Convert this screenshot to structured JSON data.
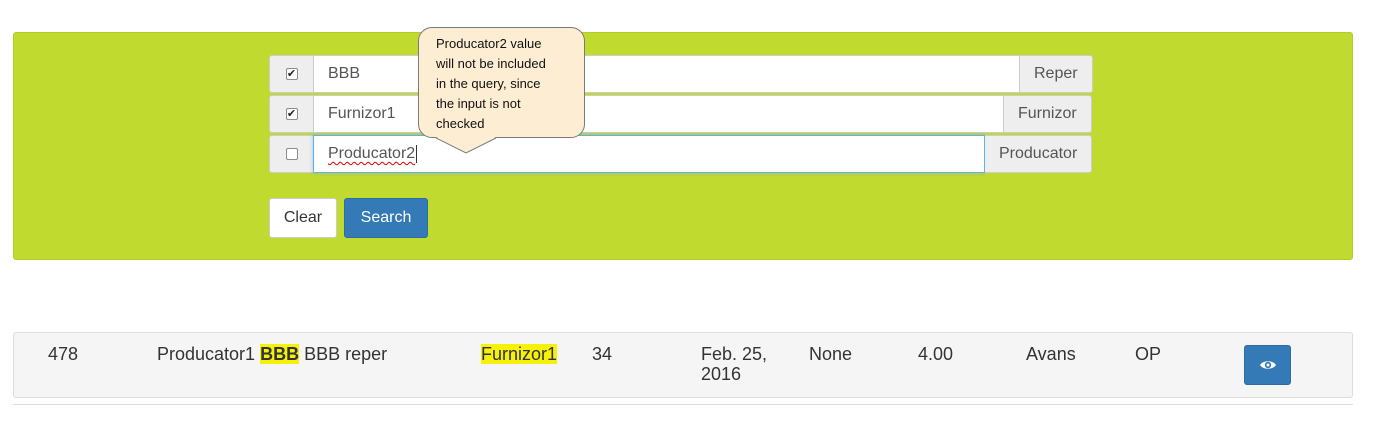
{
  "filters": [
    {
      "checked": true,
      "checked_glyph": "✔",
      "value": "BBB",
      "addon": "Reper"
    },
    {
      "checked": true,
      "checked_glyph": "✔",
      "value": "Furnizor1",
      "addon": "Furnizor"
    },
    {
      "checked": false,
      "checked_glyph": "",
      "value": "Producator2",
      "addon": "Producator"
    }
  ],
  "buttons": {
    "clear": "Clear",
    "search": "Search"
  },
  "tooltip": {
    "lines": [
      "Producator2 value",
      "will not be included",
      "in the query, since",
      "the input is not",
      "checked"
    ]
  },
  "result": {
    "id": "478",
    "producator": "Producator1",
    "reper_code": "BBB",
    "reper_name": "BBB reper",
    "furnizor": "Furnizor1",
    "quantity": "34",
    "date_line1": "Feb. 25,",
    "date_line2": "2016",
    "status": "None",
    "price": "4.00",
    "payment": "Avans",
    "type": "OP"
  },
  "colors": {
    "panel": "#c1da2f",
    "primary": "#337ab7",
    "highlight": "#f6f10a",
    "tooltip": "#fdeed3"
  }
}
